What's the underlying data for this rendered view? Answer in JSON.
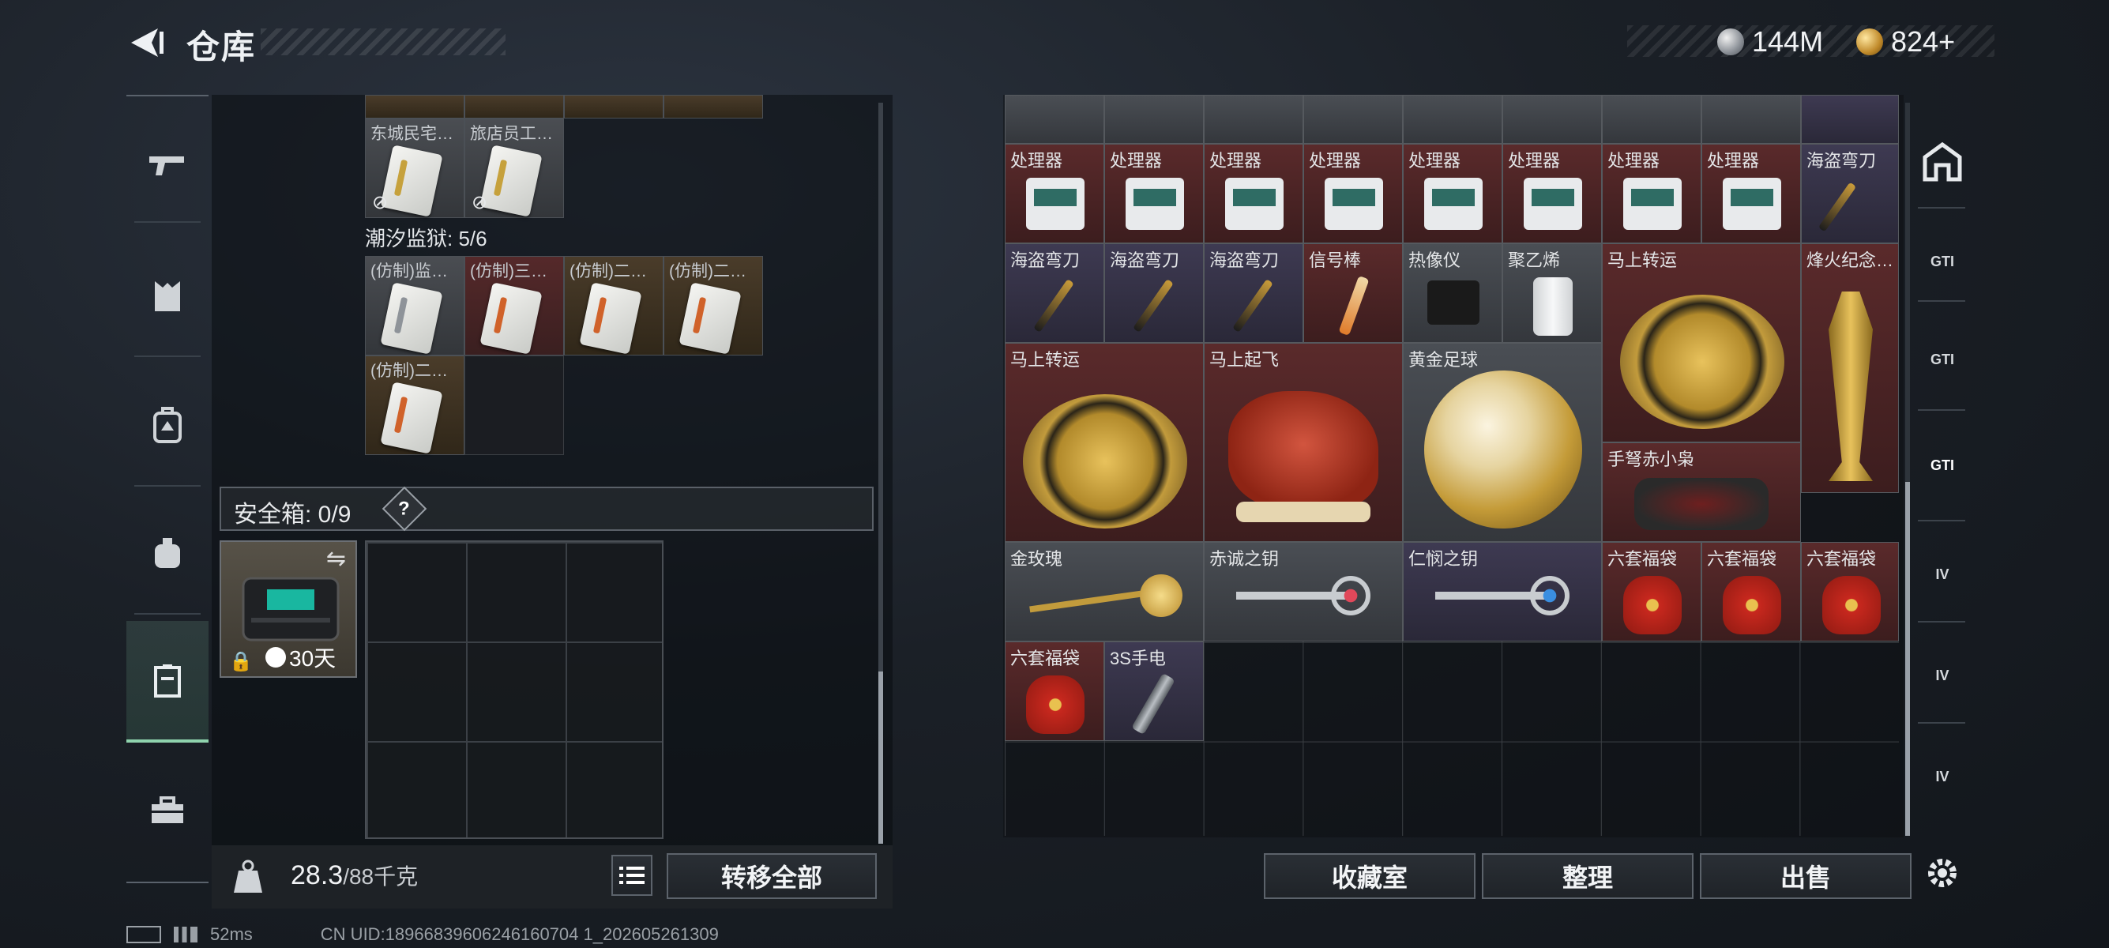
{
  "header": {
    "title": "仓库",
    "currency_silver": "144M",
    "currency_gold": "824+"
  },
  "left_nav": [
    {
      "name": "weapon",
      "icon": "gun-icon"
    },
    {
      "name": "armor",
      "icon": "vest-icon"
    },
    {
      "name": "backpack",
      "icon": "backpack-icon"
    },
    {
      "name": "rig",
      "icon": "chest-rig-icon"
    },
    {
      "name": "container",
      "icon": "container-icon",
      "active": true
    },
    {
      "name": "toolbox",
      "icon": "toolbox-icon"
    }
  ],
  "left_panel": {
    "keycards_row1": [
      "东城民宅…",
      "旅店员工…"
    ],
    "prison_title": "潮汐监狱: 5/6",
    "prison_cards": [
      "(仿制)监…",
      "(仿制)三…",
      "(仿制)二…",
      "(仿制)二…",
      "(仿制)二…"
    ],
    "safebox_label": "安全箱: 0/9",
    "safebox_help": "?",
    "safebox_timer": "30天",
    "weight": "28.3",
    "weight_max": "/88千克",
    "transfer_all": "转移全部"
  },
  "right_panel": {
    "items": [
      {
        "label": "处理器",
        "rarity": "red"
      },
      {
        "label": "处理器",
        "rarity": "red"
      },
      {
        "label": "处理器",
        "rarity": "red"
      },
      {
        "label": "处理器",
        "rarity": "red"
      },
      {
        "label": "处理器",
        "rarity": "red"
      },
      {
        "label": "处理器",
        "rarity": "red"
      },
      {
        "label": "处理器",
        "rarity": "red"
      },
      {
        "label": "处理器",
        "rarity": "red"
      },
      {
        "label": "海盗弯刀",
        "rarity": "red"
      },
      {
        "label": "海盗弯刀",
        "rarity": "purple"
      },
      {
        "label": "海盗弯刀",
        "rarity": "purple"
      },
      {
        "label": "海盗弯刀",
        "rarity": "purple"
      },
      {
        "label": "信号棒",
        "rarity": "red"
      },
      {
        "label": "热像仪",
        "rarity": "gray"
      },
      {
        "label": "聚乙烯",
        "rarity": "gray"
      },
      {
        "label": "马上转运",
        "rarity": "red"
      },
      {
        "label": "烽火纪念…",
        "rarity": "red"
      },
      {
        "label": "马上转运",
        "rarity": "red"
      },
      {
        "label": "马上起飞",
        "rarity": "red"
      },
      {
        "label": "黄金足球",
        "rarity": "gray"
      },
      {
        "label": "手弩赤小枭",
        "rarity": "red"
      },
      {
        "label": "金玫瑰",
        "rarity": "gray"
      },
      {
        "label": "赤诚之钥",
        "rarity": "gray"
      },
      {
        "label": "仁悯之钥",
        "rarity": "purple"
      },
      {
        "label": "六套福袋",
        "rarity": "red"
      },
      {
        "label": "六套福袋",
        "rarity": "red"
      },
      {
        "label": "六套福袋",
        "rarity": "red"
      },
      {
        "label": "六套福袋",
        "rarity": "red"
      },
      {
        "label": "3S手电",
        "rarity": "purple"
      }
    ],
    "buttons": [
      "收藏室",
      "整理",
      "出售"
    ]
  },
  "right_nav": [
    "GTI",
    "GTI",
    "GTI",
    "IV",
    "IV",
    "IV"
  ],
  "footer": {
    "ping": "52ms",
    "uid": "CN UID:18966839606246160704 1_202605261309"
  },
  "colors": {
    "accent": "#8fd3ad",
    "red_rarity": "#5a2a2b",
    "purple_rarity": "#3e3a52",
    "gray_rarity": "#4a4e54"
  }
}
